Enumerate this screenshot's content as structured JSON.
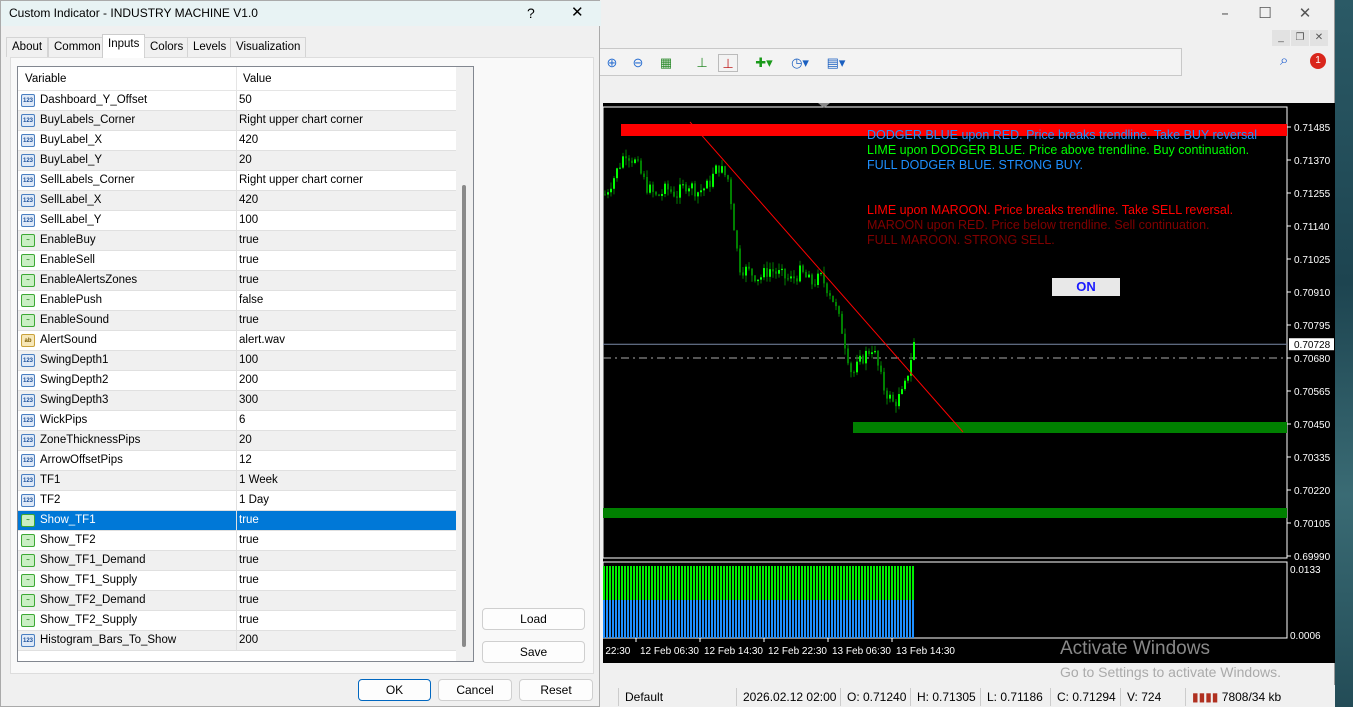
{
  "dialog": {
    "title": "Custom Indicator - INDUSTRY MACHINE V1.0",
    "help_glyph": "?",
    "close_glyph": "✕",
    "tabs": [
      {
        "label": "About"
      },
      {
        "label": "Common"
      },
      {
        "label": "Inputs",
        "active": true
      },
      {
        "label": "Colors"
      },
      {
        "label": "Levels"
      },
      {
        "label": "Visualization"
      }
    ],
    "columns": {
      "variable": "Variable",
      "value": "Value"
    },
    "rows": [
      {
        "type": "n",
        "variable": "Dashboard_Y_Offset",
        "value": "50"
      },
      {
        "type": "n",
        "variable": "BuyLabels_Corner",
        "value": "Right upper chart corner"
      },
      {
        "type": "n",
        "variable": "BuyLabel_X",
        "value": "420"
      },
      {
        "type": "n",
        "variable": "BuyLabel_Y",
        "value": "20"
      },
      {
        "type": "n",
        "variable": "SellLabels_Corner",
        "value": "Right upper chart corner"
      },
      {
        "type": "n",
        "variable": "SellLabel_X",
        "value": "420"
      },
      {
        "type": "n",
        "variable": "SellLabel_Y",
        "value": "100"
      },
      {
        "type": "b",
        "variable": "EnableBuy",
        "value": "true"
      },
      {
        "type": "b",
        "variable": "EnableSell",
        "value": "true"
      },
      {
        "type": "b",
        "variable": "EnableAlertsZones",
        "value": "true"
      },
      {
        "type": "b",
        "variable": "EnablePush",
        "value": "false"
      },
      {
        "type": "b",
        "variable": "EnableSound",
        "value": "true"
      },
      {
        "type": "s",
        "variable": "AlertSound",
        "value": "alert.wav"
      },
      {
        "type": "n",
        "variable": "SwingDepth1",
        "value": "100"
      },
      {
        "type": "n",
        "variable": "SwingDepth2",
        "value": "200"
      },
      {
        "type": "n",
        "variable": "SwingDepth3",
        "value": "300"
      },
      {
        "type": "n",
        "variable": "WickPips",
        "value": "6"
      },
      {
        "type": "n",
        "variable": "ZoneThicknessPips",
        "value": "20"
      },
      {
        "type": "n",
        "variable": "ArrowOffsetPips",
        "value": "12"
      },
      {
        "type": "n",
        "variable": "TF1",
        "value": "1 Week"
      },
      {
        "type": "n",
        "variable": "TF2",
        "value": "1 Day"
      },
      {
        "type": "b",
        "variable": "Show_TF1",
        "value": "true",
        "selected": true
      },
      {
        "type": "b",
        "variable": "Show_TF2",
        "value": "true"
      },
      {
        "type": "b",
        "variable": "Show_TF1_Demand",
        "value": "true"
      },
      {
        "type": "b",
        "variable": "Show_TF1_Supply",
        "value": "true"
      },
      {
        "type": "b",
        "variable": "Show_TF2_Demand",
        "value": "true"
      },
      {
        "type": "b",
        "variable": "Show_TF2_Supply",
        "value": "true"
      },
      {
        "type": "n",
        "variable": "Histogram_Bars_To_Show",
        "value": "200"
      }
    ],
    "load_label": "Load",
    "save_label": "Save",
    "ok_label": "OK",
    "cancel_label": "Cancel",
    "reset_label": "Reset"
  },
  "chart": {
    "legend_lines": [
      {
        "text": "DODGER BLUE upon RED. Price breaks trendline. Take BUY reversal",
        "color": "#1e90ff"
      },
      {
        "text": "LIME upon DODGER BLUE. Price above trendline. Buy continuation.",
        "color": "#00ff00"
      },
      {
        "text": "FULL DODGER BLUE. STRONG BUY.",
        "color": "#1e90ff"
      },
      {
        "text": "LIME upon MAROON. Price breaks trendline. Take SELL reversal.",
        "color": "#ff0000"
      },
      {
        "text": "MAROON upon RED. Price below trendline. Sell continuation.",
        "color": "#800000"
      },
      {
        "text": "FULL MAROON. STRONG SELL.",
        "color": "#800000"
      }
    ],
    "on_button": "ON",
    "price_ticks": [
      "0.71485",
      "0.71370",
      "0.71255",
      "0.71140",
      "0.71025",
      "0.70910",
      "0.70795",
      "0.70680",
      "0.70565",
      "0.70450",
      "0.70335",
      "0.70220",
      "0.70105",
      "0.69990"
    ],
    "current_price": "0.70728",
    "indicator_ticks": [
      "0.0133",
      "0.0006"
    ],
    "time_labels": [
      "b 22:30",
      "12 Feb 06:30",
      "12 Feb 14:30",
      "12 Feb 22:30",
      "13 Feb 06:30",
      "13 Feb 14:30"
    ],
    "closes": [
      0.7125,
      0.7132,
      0.714,
      0.7136,
      0.7128,
      0.7124,
      0.7127,
      0.7125,
      0.7129,
      0.7126,
      0.7128,
      0.7135,
      0.713,
      0.71,
      0.7098,
      0.7096,
      0.7099,
      0.7097,
      0.7095,
      0.7098,
      0.7094,
      0.7096,
      0.709,
      0.7078,
      0.7062,
      0.7068,
      0.7072,
      0.7058,
      0.7052,
      0.7056,
      0.7073
    ],
    "colors": {
      "supply_zone": "#ff0000",
      "demand_zone": "#008000",
      "trendline": "#ff0000",
      "bull": "#00ff00",
      "bear": "#008000",
      "hist_top": "#00ee00",
      "hist_bottom": "#1e8fff"
    },
    "watermark": [
      "Activate Windows",
      "Go to Settings to activate Windows."
    ]
  },
  "status": {
    "profile": "Default",
    "time": "2026.02.12 02:00",
    "open": "O: 0.71240",
    "high": "H: 0.71305",
    "low": "L: 0.71186",
    "close": "C: 0.71294",
    "volume": "V: 724",
    "traffic": "7808/34 kb"
  },
  "notification_count": "1"
}
